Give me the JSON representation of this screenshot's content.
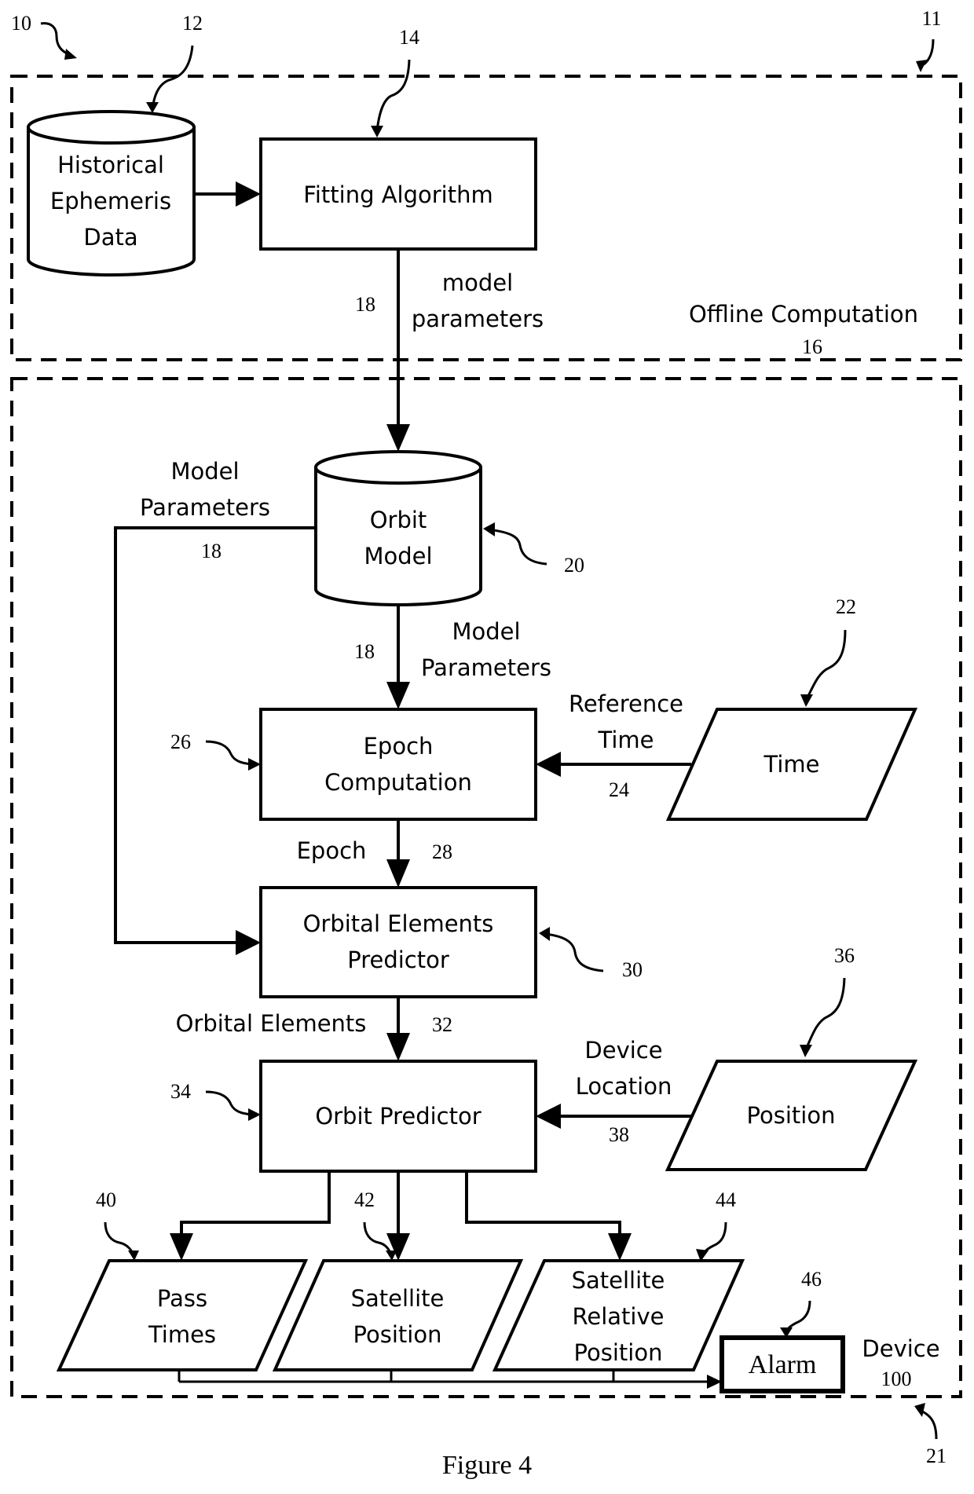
{
  "figure": {
    "caption": "Figure 4",
    "system_ref": "10",
    "regions": {
      "offline": {
        "ref": "11",
        "label": "Offline Computation",
        "label_ref": "16"
      },
      "device": {
        "ref": "21",
        "label": "Device",
        "label_ref": "100"
      }
    },
    "nodes": {
      "historical": {
        "ref": "12",
        "lines": [
          "Historical",
          "Ephemeris",
          "Data"
        ],
        "shape": "database"
      },
      "fitting": {
        "ref": "14",
        "lines": [
          "Fitting Algorithm"
        ],
        "shape": "process"
      },
      "orbit_model": {
        "ref": "20",
        "lines": [
          "Orbit",
          "Model"
        ],
        "shape": "database"
      },
      "time": {
        "ref": "22",
        "lines": [
          "Time"
        ],
        "shape": "data"
      },
      "epoch": {
        "ref": "26",
        "lines": [
          "Epoch",
          "Computation"
        ],
        "shape": "process"
      },
      "oe_predictor": {
        "ref": "30",
        "lines": [
          "Orbital Elements",
          "Predictor"
        ],
        "shape": "process"
      },
      "position": {
        "ref": "36",
        "lines": [
          "Position"
        ],
        "shape": "data"
      },
      "orbit_predictor": {
        "ref": "34",
        "lines": [
          "Orbit Predictor"
        ],
        "shape": "process"
      },
      "pass_times": {
        "ref": "40",
        "lines": [
          "Pass",
          "Times"
        ],
        "shape": "data"
      },
      "sat_position": {
        "ref": "42",
        "lines": [
          "Satellite",
          "Position"
        ],
        "shape": "data"
      },
      "sat_rel_position": {
        "ref": "44",
        "lines": [
          "Satellite",
          "Relative",
          "Position"
        ],
        "shape": "data"
      },
      "alarm": {
        "ref": "46",
        "lines": [
          "Alarm"
        ],
        "shape": "process"
      }
    },
    "edges": {
      "fit_to_model": {
        "ref": "18",
        "lines": [
          "model",
          "parameters"
        ]
      },
      "model_to_oe": {
        "ref": "18",
        "lines": [
          "Model",
          "Parameters"
        ]
      },
      "model_to_epoch": {
        "ref": "18",
        "lines": [
          "Model",
          "Parameters"
        ]
      },
      "time_to_epoch": {
        "ref": "24",
        "lines": [
          "Reference",
          "Time"
        ]
      },
      "epoch_to_oe": {
        "ref": "28",
        "lines": [
          "Epoch"
        ]
      },
      "oe_to_orbit": {
        "ref": "32",
        "lines": [
          "Orbital Elements"
        ]
      },
      "position_to_orbit": {
        "ref": "38",
        "lines": [
          "Device",
          "Location"
        ]
      }
    }
  }
}
